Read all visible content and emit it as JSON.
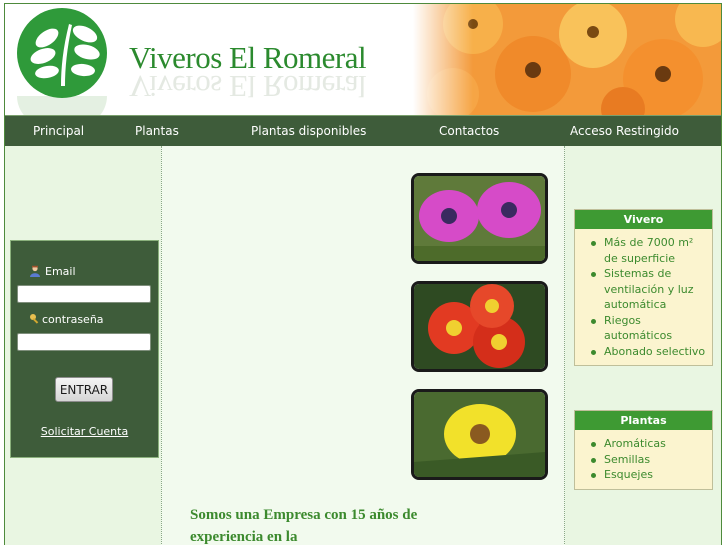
{
  "brand": {
    "name": "Viveros El Romeral",
    "logo_icon": "leaf-logo-icon"
  },
  "nav": {
    "items": [
      {
        "label": "Principal"
      },
      {
        "label": "Plantas"
      },
      {
        "label": "Plantas disponibles"
      },
      {
        "label": "Contactos"
      },
      {
        "label": "Acceso Restingido"
      }
    ]
  },
  "login": {
    "email_label": "Email",
    "email_value": "",
    "password_label": "contraseña",
    "password_value": "",
    "enter_label": "ENTRAR",
    "request_label": "Solicitar Cuenta",
    "email_icon": "user-icon",
    "password_icon": "key-icon"
  },
  "center": {
    "intro": "Somos una Empresa con 15 años de experiencia en la",
    "photos": [
      {
        "name": "pink-daisy-photo"
      },
      {
        "name": "red-flower-photo"
      },
      {
        "name": "yellow-daisy-photo"
      }
    ]
  },
  "vivero_box": {
    "title": "Vivero",
    "items": [
      "Más de 7000 m² de superficie",
      "Sistemas de ventilación y luz automática",
      "Riegos automáticos",
      "Abonado selectivo"
    ]
  },
  "plantas_box": {
    "title": "Plantas",
    "items": [
      "Aromáticas",
      "Semillas",
      "Esquejes"
    ]
  },
  "colors": {
    "nav_bg": "#3e5c3a",
    "accent_green": "#3e9a33",
    "text_green": "#3c8a2e",
    "box_bg": "#fbf4cf",
    "page_bg": "#e9f6e2"
  }
}
